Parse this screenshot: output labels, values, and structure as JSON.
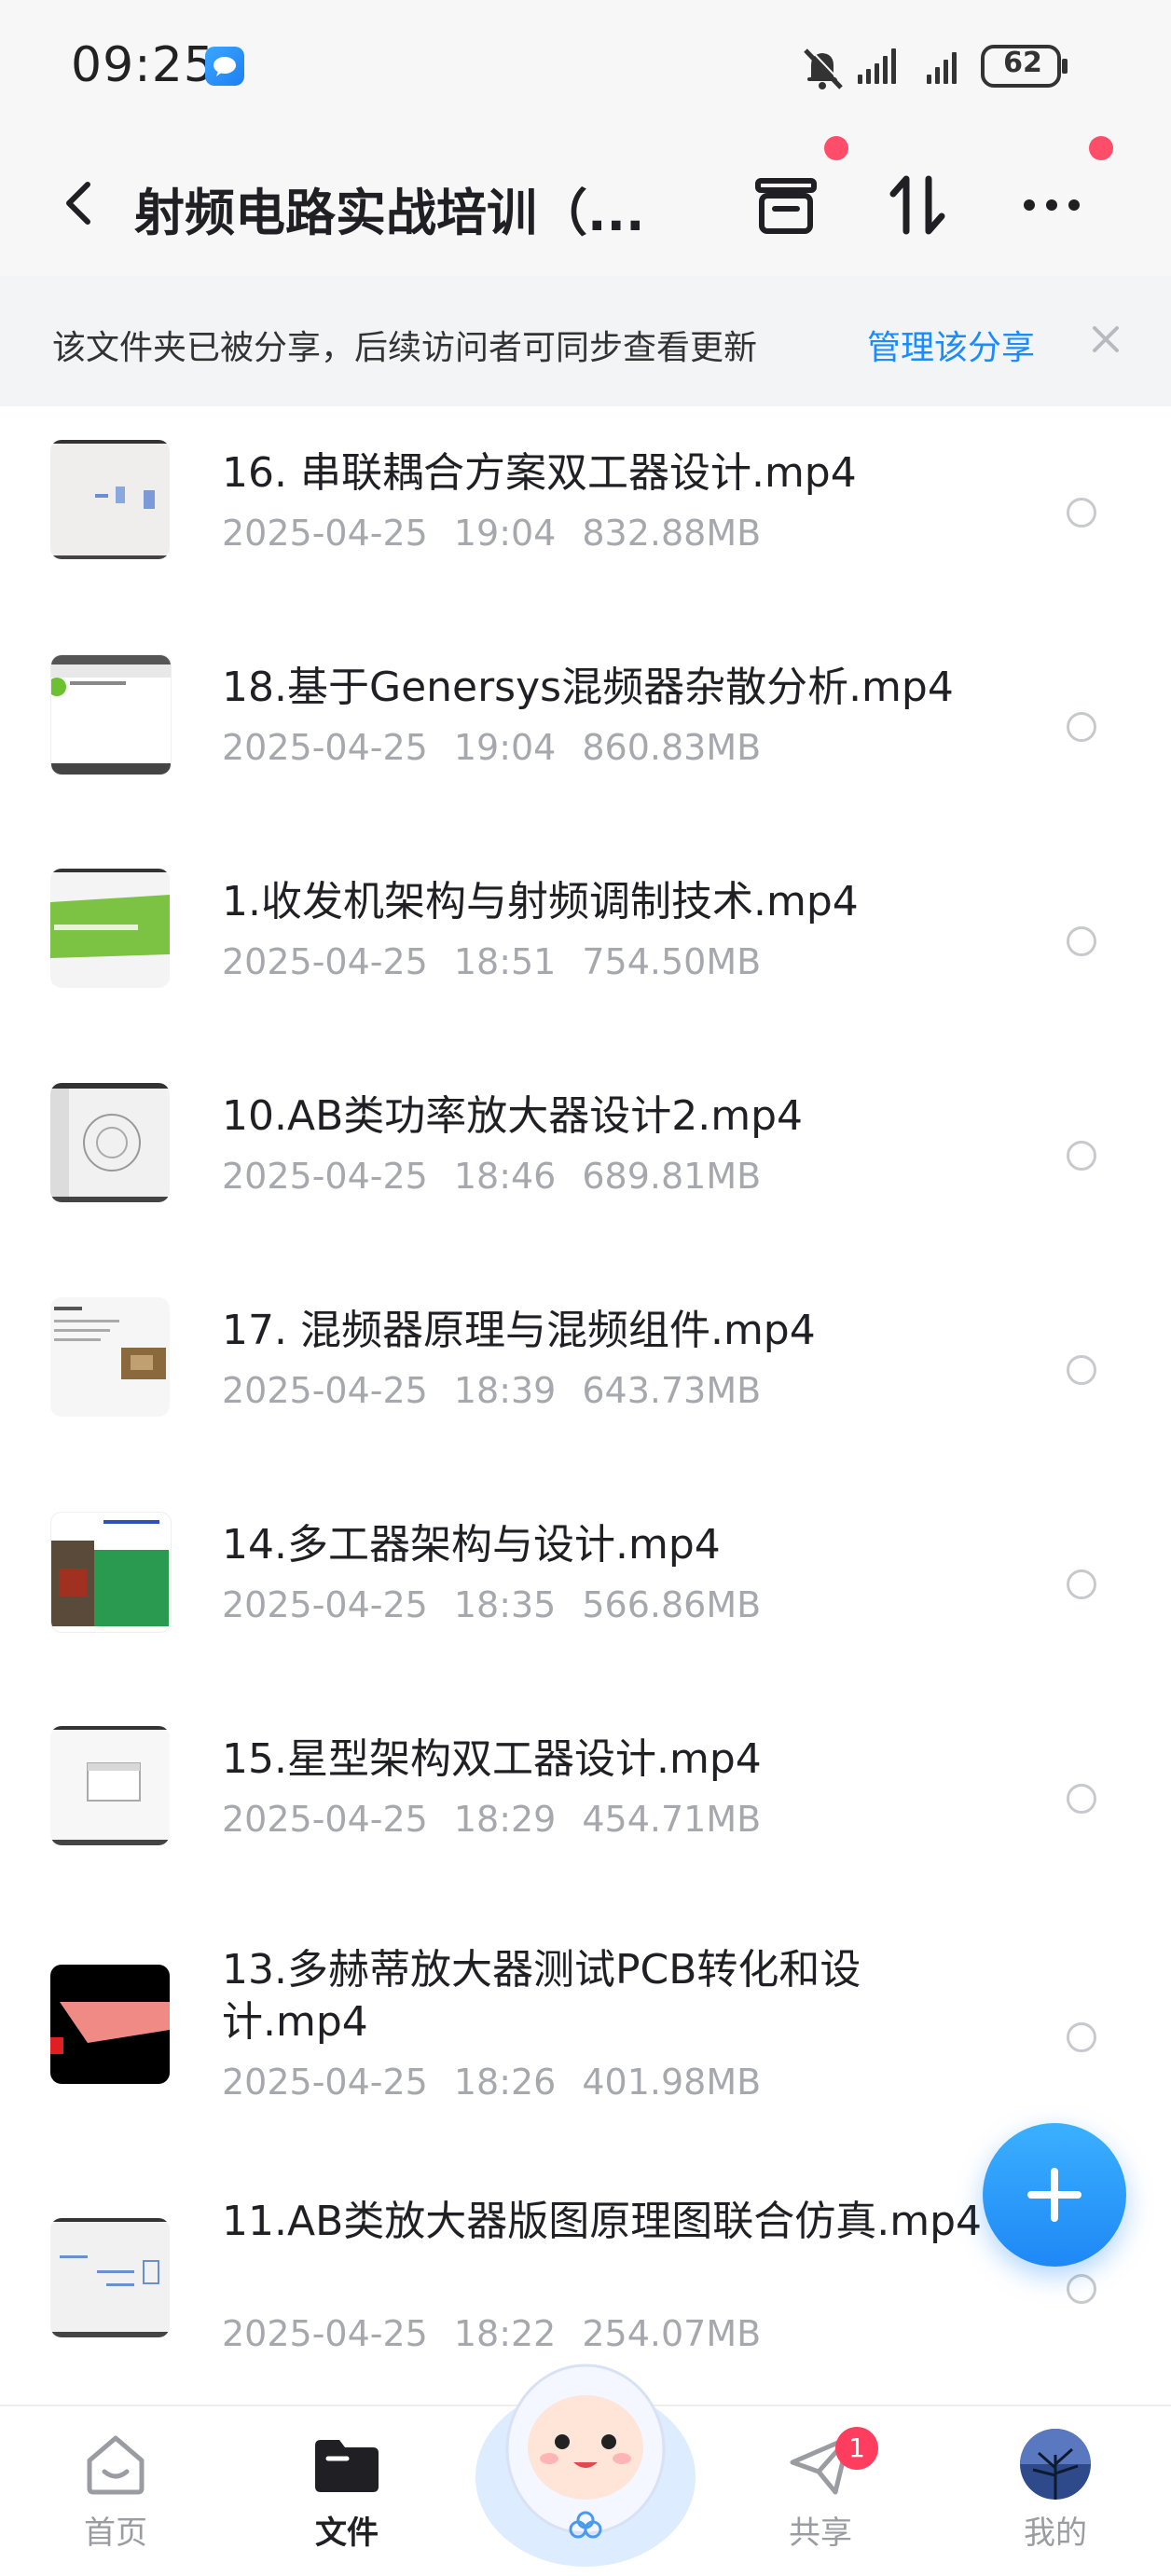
{
  "status_bar": {
    "time": "09:25",
    "battery": "62"
  },
  "header": {
    "title": "射频电路实战培训（..."
  },
  "share_banner": {
    "text": "该文件夹已被分享，后续访问者可同步查看更新",
    "manage_label": "管理该分享"
  },
  "files": [
    {
      "name": "16. 串联耦合方案双工器设计.mp4",
      "date": "2025-04-25",
      "time": "19:04",
      "size": "832.88MB"
    },
    {
      "name": "18.基于Genersys混频器杂散分析.mp4",
      "date": "2025-04-25",
      "time": "19:04",
      "size": "860.83MB"
    },
    {
      "name": "1.收发机架构与射频调制技术.mp4",
      "date": "2025-04-25",
      "time": "18:51",
      "size": "754.50MB"
    },
    {
      "name": "10.AB类功率放大器设计2.mp4",
      "date": "2025-04-25",
      "time": "18:46",
      "size": "689.81MB"
    },
    {
      "name": "17. 混频器原理与混频组件.mp4",
      "date": "2025-04-25",
      "time": "18:39",
      "size": "643.73MB"
    },
    {
      "name": "14.多工器架构与设计.mp4",
      "date": "2025-04-25",
      "time": "18:35",
      "size": "566.86MB"
    },
    {
      "name": "15.星型架构双工器设计.mp4",
      "date": "2025-04-25",
      "time": "18:29",
      "size": "454.71MB"
    },
    {
      "name": "13.多赫蒂放大器测试PCB转化和设计.mp4",
      "date": "2025-04-25",
      "time": "18:26",
      "size": "401.98MB"
    },
    {
      "name": "11.AB类放大器版图原理图联合仿真.mp4",
      "date": "2025-04-25",
      "time": "18:22",
      "size": "254.07MB"
    }
  ],
  "nav": {
    "home": "首页",
    "files": "文件",
    "share": "共享",
    "share_badge": "1",
    "me": "我的"
  }
}
